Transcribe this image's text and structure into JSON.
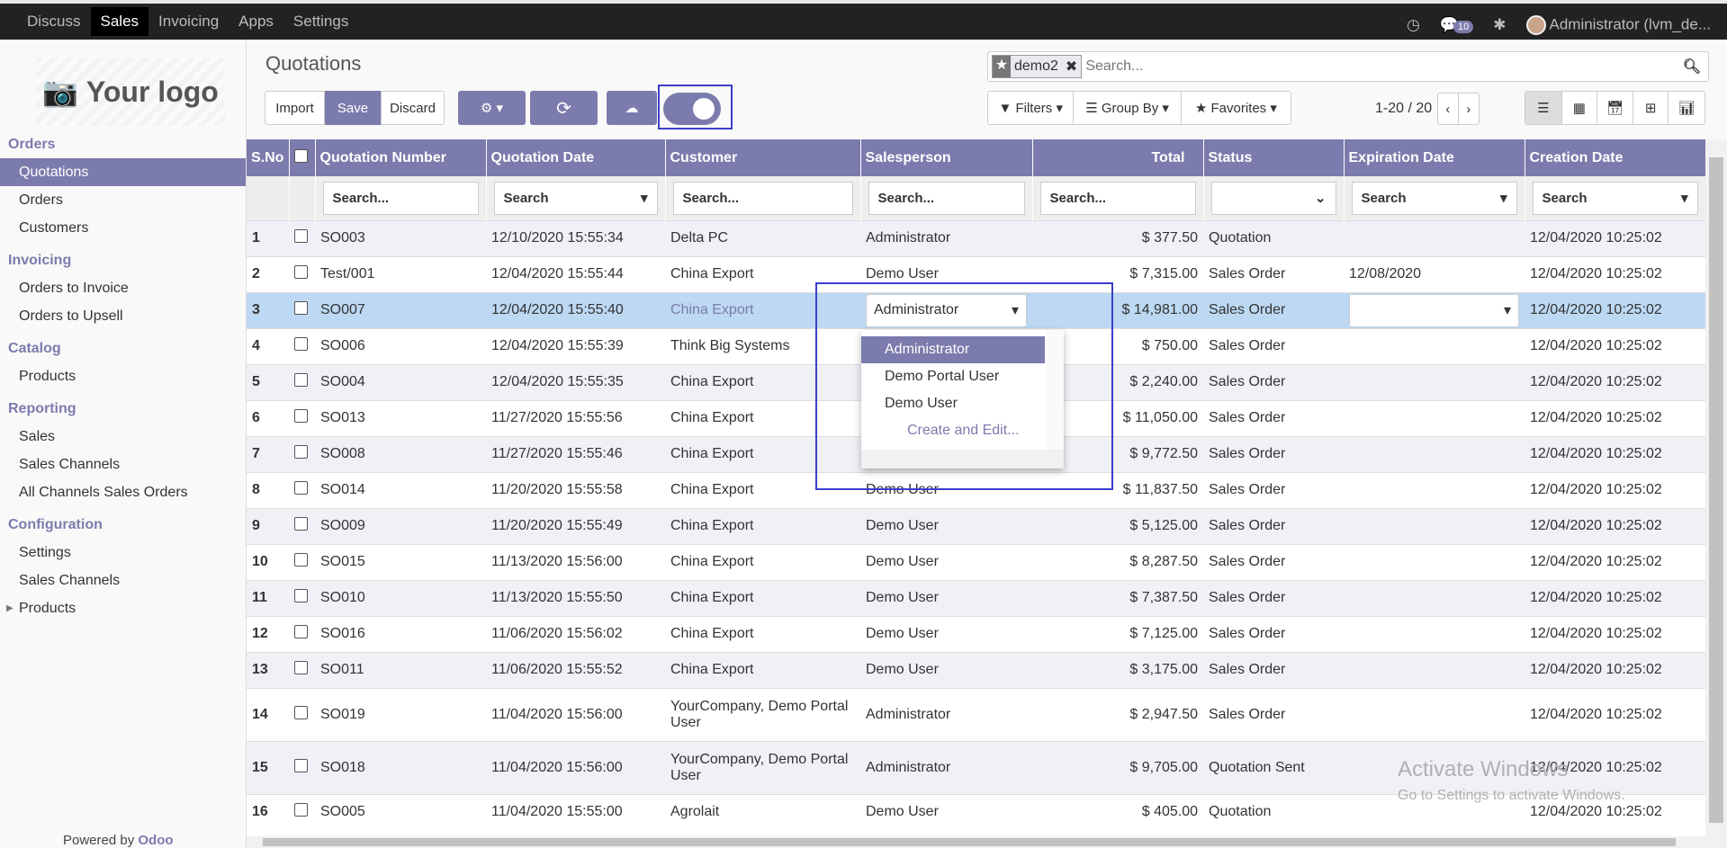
{
  "topbar": {
    "menus": [
      "Discuss",
      "Sales",
      "Invoicing",
      "Apps",
      "Settings"
    ],
    "active": "Sales",
    "message_count": "10",
    "user": "Administrator (lvm_de..."
  },
  "sidebar": {
    "logo": "Your logo",
    "sections": [
      {
        "title": "Orders",
        "items": [
          "Quotations",
          "Orders",
          "Customers"
        ]
      },
      {
        "title": "Invoicing",
        "items": [
          "Orders to Invoice",
          "Orders to Upsell"
        ]
      },
      {
        "title": "Catalog",
        "items": [
          "Products"
        ]
      },
      {
        "title": "Reporting",
        "items": [
          "Sales",
          "Sales Channels",
          "All Channels Sales Orders"
        ]
      },
      {
        "title": "Configuration",
        "items": [
          "Settings",
          "Sales Channels",
          "Products"
        ]
      }
    ],
    "active": "Quotations",
    "powered_prefix": "Powered by ",
    "powered_brand": "Odoo"
  },
  "control": {
    "title": "Quotations",
    "import": "Import",
    "save": "Save",
    "discard": "Discard",
    "facet": "demo2",
    "search_placeholder": "Search...",
    "filters": "Filters",
    "group_by": "Group By",
    "favorites": "Favorites",
    "pager": "1-20 / 20",
    "toggle_on": true
  },
  "table": {
    "headers": [
      "S.No",
      "Quotation Number",
      "Quotation Date",
      "Customer",
      "Salesperson",
      "Total",
      "Status",
      "Expiration Date",
      "Creation Date"
    ],
    "filters": [
      "Search...",
      "Search",
      "Search...",
      "Search...",
      "Search...",
      "",
      "Search",
      "Search"
    ],
    "rows": [
      [
        "1",
        "SO003",
        "12/10/2020 15:55:34",
        "Delta PC",
        "Administrator",
        "$ 377.50",
        "Quotation",
        "",
        "12/04/2020 10:25:02"
      ],
      [
        "2",
        "Test/001",
        "12/04/2020 15:55:44",
        "China Export",
        "Demo User",
        "$ 7,315.00",
        "Sales Order",
        "12/08/2020",
        "12/04/2020 10:25:02"
      ],
      [
        "3",
        "SO007",
        "12/04/2020 15:55:40",
        "China Export",
        "Administrator",
        "$ 14,981.00",
        "Sales Order",
        "",
        "12/04/2020 10:25:02"
      ],
      [
        "4",
        "SO006",
        "12/04/2020 15:55:39",
        "Think Big Systems",
        "",
        "$ 750.00",
        "Sales Order",
        "",
        "12/04/2020 10:25:02"
      ],
      [
        "5",
        "SO004",
        "12/04/2020 15:55:35",
        "China Export",
        "",
        "$ 2,240.00",
        "Sales Order",
        "",
        "12/04/2020 10:25:02"
      ],
      [
        "6",
        "SO013",
        "11/27/2020 15:55:56",
        "China Export",
        "",
        "$ 11,050.00",
        "Sales Order",
        "",
        "12/04/2020 10:25:02"
      ],
      [
        "7",
        "SO008",
        "11/27/2020 15:55:46",
        "China Export",
        "",
        "$ 9,772.50",
        "Sales Order",
        "",
        "12/04/2020 10:25:02"
      ],
      [
        "8",
        "SO014",
        "11/20/2020 15:55:58",
        "China Export",
        "Demo User",
        "$ 11,837.50",
        "Sales Order",
        "",
        "12/04/2020 10:25:02"
      ],
      [
        "9",
        "SO009",
        "11/20/2020 15:55:49",
        "China Export",
        "Demo User",
        "$ 5,125.00",
        "Sales Order",
        "",
        "12/04/2020 10:25:02"
      ],
      [
        "10",
        "SO015",
        "11/13/2020 15:56:00",
        "China Export",
        "Demo User",
        "$ 8,287.50",
        "Sales Order",
        "",
        "12/04/2020 10:25:02"
      ],
      [
        "11",
        "SO010",
        "11/13/2020 15:55:50",
        "China Export",
        "Demo User",
        "$ 7,387.50",
        "Sales Order",
        "",
        "12/04/2020 10:25:02"
      ],
      [
        "12",
        "SO016",
        "11/06/2020 15:56:02",
        "China Export",
        "Demo User",
        "$ 7,125.00",
        "Sales Order",
        "",
        "12/04/2020 10:25:02"
      ],
      [
        "13",
        "SO011",
        "11/06/2020 15:55:52",
        "China Export",
        "Demo User",
        "$ 3,175.00",
        "Sales Order",
        "",
        "12/04/2020 10:25:02"
      ],
      [
        "14",
        "SO019",
        "11/04/2020 15:56:00",
        "YourCompany, Demo Portal User",
        "Administrator",
        "$ 2,947.50",
        "Sales Order",
        "",
        "12/04/2020 10:25:02"
      ],
      [
        "15",
        "SO018",
        "11/04/2020 15:56:00",
        "YourCompany, Demo Portal User",
        "Administrator",
        "$ 9,705.00",
        "Quotation Sent",
        "",
        "12/04/2020 10:25:02"
      ],
      [
        "16",
        "SO005",
        "11/04/2020 15:55:00",
        "Agrolait",
        "Demo User",
        "$ 405.00",
        "Quotation",
        "",
        "12/04/2020 10:25:02"
      ]
    ],
    "editing_row": 3
  },
  "dropdown": {
    "options": [
      "Administrator",
      "Demo Portal User",
      "Demo User"
    ],
    "selected": "Administrator",
    "create": "Create and Edit..."
  },
  "watermark": {
    "title": "Activate Windows",
    "subtitle": "Go to Settings to activate Windows."
  },
  "colors": {
    "brand": "#7c7bad",
    "selected_row": "#bcd8f2",
    "highlight_box": "#3b3fc8"
  }
}
